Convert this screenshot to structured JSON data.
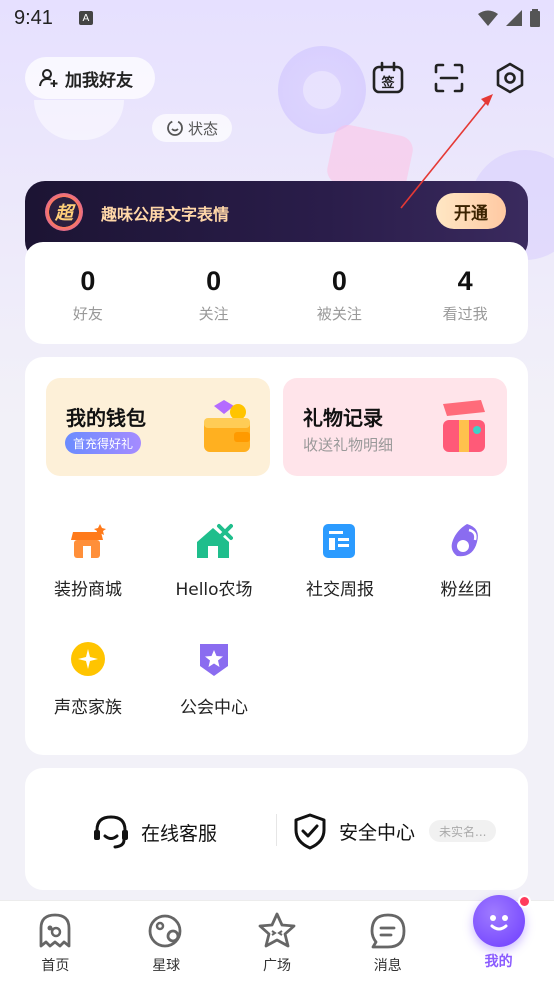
{
  "status_bar": {
    "time": "9:41",
    "notif_glyph": "A"
  },
  "header": {
    "add_friend_label": "加我好友",
    "sign_in_glyph": "签",
    "status_chip_label": "状态"
  },
  "vip_banner": {
    "badge_glyph": "超",
    "text": "趣味公屏文字表情",
    "button_label": "开通"
  },
  "stats": [
    {
      "value": "0",
      "label": "好友"
    },
    {
      "value": "0",
      "label": "关注"
    },
    {
      "value": "0",
      "label": "被关注"
    },
    {
      "value": "4",
      "label": "看过我"
    }
  ],
  "promos": {
    "wallet": {
      "title": "我的钱包",
      "tag": "首充得好礼"
    },
    "gift": {
      "title": "礼物记录",
      "subtitle": "收送礼物明细"
    }
  },
  "features": [
    {
      "label": "装扮商城",
      "icon": "shop-icon"
    },
    {
      "label": "Hello农场",
      "icon": "farm-icon"
    },
    {
      "label": "社交周报",
      "icon": "report-icon"
    },
    {
      "label": "粉丝团",
      "icon": "fan-club-icon"
    },
    {
      "label": "声恋家族",
      "icon": "family-icon"
    },
    {
      "label": "公会中心",
      "icon": "guild-icon"
    }
  ],
  "services": {
    "support_label": "在线客服",
    "security_label": "安全中心",
    "verify_tag": "未实名..."
  },
  "tabs": [
    {
      "label": "首页",
      "icon": "home-ghost-icon"
    },
    {
      "label": "星球",
      "icon": "planet-icon"
    },
    {
      "label": "广场",
      "icon": "star-square-icon"
    },
    {
      "label": "消息",
      "icon": "message-icon"
    },
    {
      "label": "我的",
      "icon": "me-icon",
      "active": true
    }
  ],
  "colors": {
    "accent": "#8b5cff",
    "vip_bg": "#1c1433",
    "badge_red": "#ff3b5c",
    "annotation_arrow": "#e53935"
  }
}
